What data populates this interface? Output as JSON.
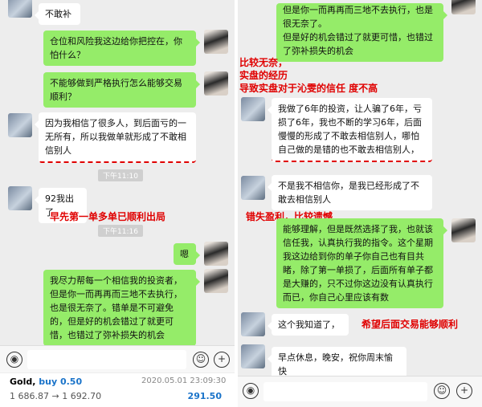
{
  "left": {
    "messages": [
      {
        "text": "不敢补"
      },
      {
        "text": "仓位和风险我这边给你把控在，你怕什么？"
      },
      {
        "text": "不能够做到严格执行怎么能够交易顺利？"
      },
      {
        "text": "因为我相信了很多人，到后面亏的一无所有，所以我做单就形成了不敢相信别人"
      },
      {
        "text": "92我出了"
      },
      {
        "text": "嗯"
      },
      {
        "text": "我尽力帮每一个相信我的投资者，但是你一而再再而三地不去执行，也是很无奈了。错单是不可避免的，但是好的机会错过了就更可惜，也错过了弥补损失的机会"
      }
    ],
    "timestamps": [
      "下午11:10",
      "下午11:16"
    ],
    "annotations": [
      "早先第一单多单已顺利出局"
    ],
    "trade": {
      "symbol": "Gold,",
      "side": "buy 0.50",
      "prices": "1 686.87 → 1 692.70",
      "datetime": "2020.05.01 23:09:30",
      "profit": "291.50"
    }
  },
  "right": {
    "messages": [
      {
        "text": "但是你一而再再而三地不去执行，也是很无奈了。"
      },
      {
        "text": "但是好的机会错过了就更可惜，也错过了弥补损失的机会"
      },
      {
        "text": "我做了6年的投资，让人骗了6年，亏损了6年，我也不断的学习6年，后面慢慢的形成了不敢去相信别人，哪怕自己做的是错的也不敢去相信别人，"
      },
      {
        "text": "不是我不相信你，是我已经形成了不敢去相信别人"
      },
      {
        "text": "能够理解，但是既然选择了我，也就该信任我，认真执行我的指令。这个星期我这边给到你的单子你自己也有目共睹，除了第一单损了，后面所有单子都是大赚的，只不过你这边没有认真执行而已，你自己心里应该有数"
      },
      {
        "text": "这个我知道了，"
      },
      {
        "text": "早点休息，晚安，祝你周末愉快"
      }
    ],
    "annotations": [
      "比较无奈，",
      "实盘的经历",
      "导致实盘对于沁雯的信任 度不高",
      "错失盈利，比较遗憾",
      "希望后面交易能够顺利"
    ]
  },
  "icons": {
    "voice": "voice-icon",
    "emoji": "emoji-icon",
    "plus": "plus-icon"
  },
  "colors": {
    "outgoing_bubble": "#95ec69",
    "annotation": "#e00000",
    "profit": "#1a73c9"
  }
}
